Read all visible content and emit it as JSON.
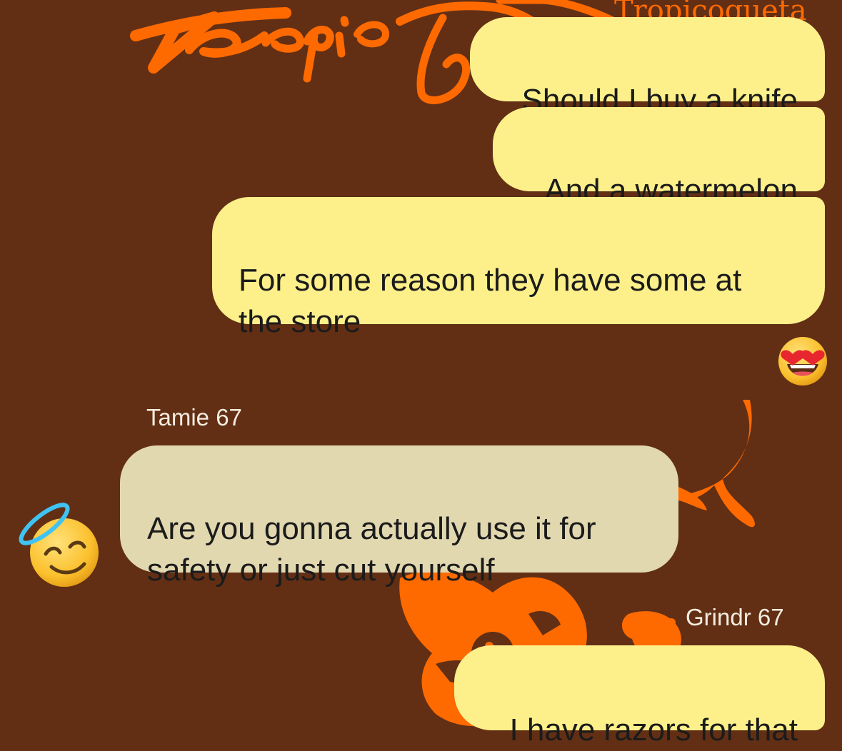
{
  "wallpaper": {
    "brand_text": "Tropicoqueta",
    "background_color": "#622f15",
    "accent_color": "#ff6a00"
  },
  "messages": [
    {
      "direction": "outgoing",
      "text": "Should I buy a knife"
    },
    {
      "direction": "outgoing",
      "text": "And a watermelon"
    },
    {
      "direction": "outgoing",
      "text": "For some reason they have some at\nthe store",
      "reaction": "heart-eyes-emoji"
    },
    {
      "direction": "incoming",
      "sender": "Tamie 67",
      "text": "Are you gonna actually use it for\nsafety or just cut yourself",
      "avatar": "smiling-face-with-halo-emoji"
    },
    {
      "direction": "outgoing",
      "sender": "Grindr 67",
      "text": "I have razors for that"
    }
  ],
  "colors": {
    "outgoing_bubble": "#fdf08b",
    "incoming_bubble": "#e2d8b0",
    "sender_name": "#f4ecdf"
  }
}
